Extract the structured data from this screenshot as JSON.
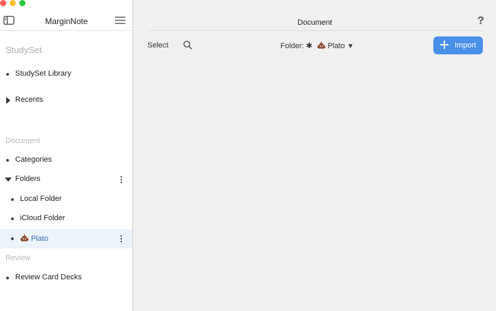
{
  "window": {
    "traffic_lights": [
      "close",
      "minimize",
      "zoom"
    ]
  },
  "sidebar": {
    "app_title": "MarginNote",
    "sections": {
      "studyset": "StudySet",
      "document": "Document",
      "review": "Review"
    },
    "items": {
      "studyset_library": "StudySet Library",
      "recents": "Recents",
      "categories": "Categories",
      "folders": "Folders",
      "local_folder": "Local Folder",
      "icloud_folder": "iCloud Folder",
      "plato": "Plato",
      "review_card_decks": "Review Card Decks"
    },
    "selected_item": "plato"
  },
  "main": {
    "title": "Document",
    "help": "?",
    "select_label": "Select",
    "folder_prefix": "Folder: ✱",
    "folder_name": "Plato",
    "folder_dropdown": "▼",
    "import_label": "Import"
  },
  "colors": {
    "accent": "#4a8fe8",
    "selected_text": "#2f6fb6",
    "selected_bg": "#edf3fb"
  }
}
